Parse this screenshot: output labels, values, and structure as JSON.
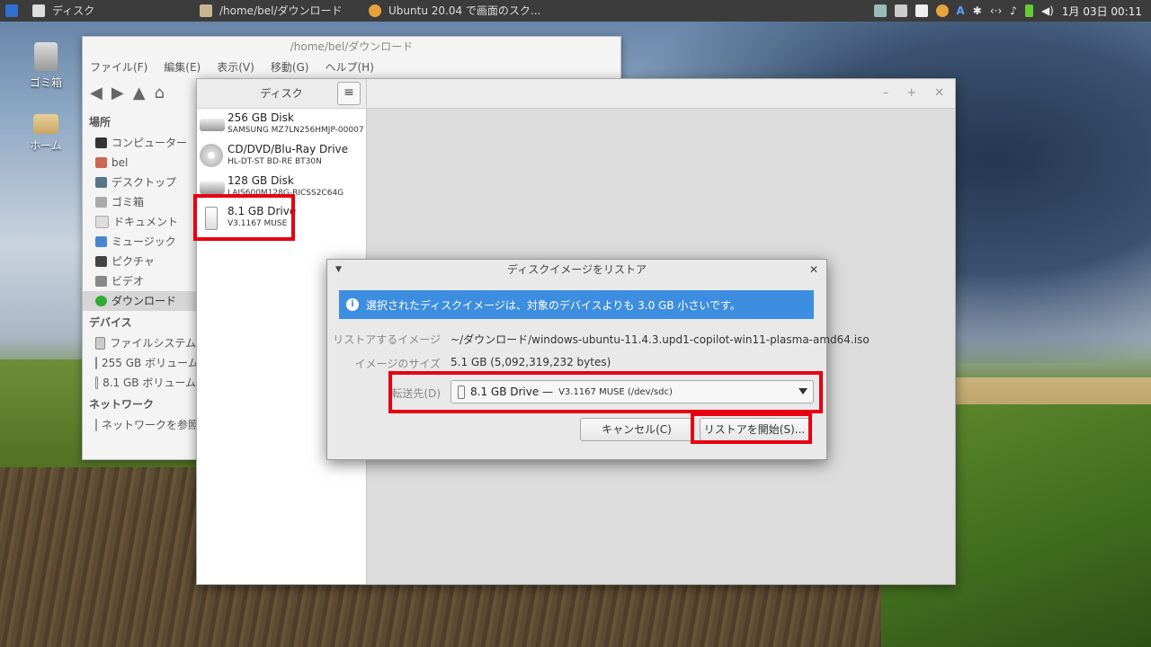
{
  "panel": {
    "app_menu": "ディスク",
    "task1": "/home/bel/ダウンロード",
    "task2": "Ubuntu 20.04 で画面のスク...",
    "tray_letter": "A",
    "clock": "1月 03日 00:11"
  },
  "desktop": {
    "trash": "ゴミ箱",
    "home": "ホーム"
  },
  "file_manager": {
    "title": "/home/bel/ダウンロード",
    "menu": [
      "ファイル(F)",
      "編集(E)",
      "表示(V)",
      "移動(G)",
      "ヘルプ(H)"
    ],
    "places_header": "場所",
    "places": [
      "コンピューター",
      "bel",
      "デスクトップ",
      "ゴミ箱",
      "ドキュメント",
      "ミュージック",
      "ピクチャ",
      "ビデオ",
      "ダウンロード"
    ],
    "devices_header": "デバイス",
    "devices": [
      "ファイルシステム",
      "255 GB ボリューム",
      "8.1 GB ボリューム"
    ],
    "network_header": "ネットワーク",
    "network": [
      "ネットワークを参照"
    ]
  },
  "disks": {
    "title": "ディスク",
    "menu_icon": "≡",
    "devices": [
      {
        "name": "256 GB Disk",
        "model": "SAMSUNG MZ7LN256HMJP-00007",
        "icon": "hdd-icon"
      },
      {
        "name": "CD/DVD/Blu-Ray Drive",
        "model": "HL-DT-ST BD-RE BT30N",
        "icon": "optical-icon"
      },
      {
        "name": "128 GB Disk",
        "model": "LAJS600M128G-RICSS2C64G",
        "icon": "hdd-icon"
      },
      {
        "name": "8.1 GB Drive",
        "model": "V3.1167 MUSE",
        "icon": "usb-icon"
      }
    ]
  },
  "dialog": {
    "title": "ディスクイメージをリストア",
    "info": "選択されたディスクイメージは、対象のデバイスよりも 3.0 GB 小さいです。",
    "image_label": "リストアするイメージ",
    "image_value": "~/ダウンロード/windows-ubuntu-11.4.3.upd1-copilot-win11-plasma-amd64.iso",
    "size_label": "イメージのサイズ",
    "size_value": "5.1 GB (5,092,319,232 bytes)",
    "dest_label": "転送先(D)",
    "dest_name": "8.1 GB Drive —",
    "dest_detail": "V3.1167 MUSE (/dev/sdc)",
    "cancel": "キャンセル(C)",
    "start": "リストアを開始(S)..."
  },
  "colors": {
    "highlight": "#e60012",
    "info_bar": "#3d8ee0"
  }
}
